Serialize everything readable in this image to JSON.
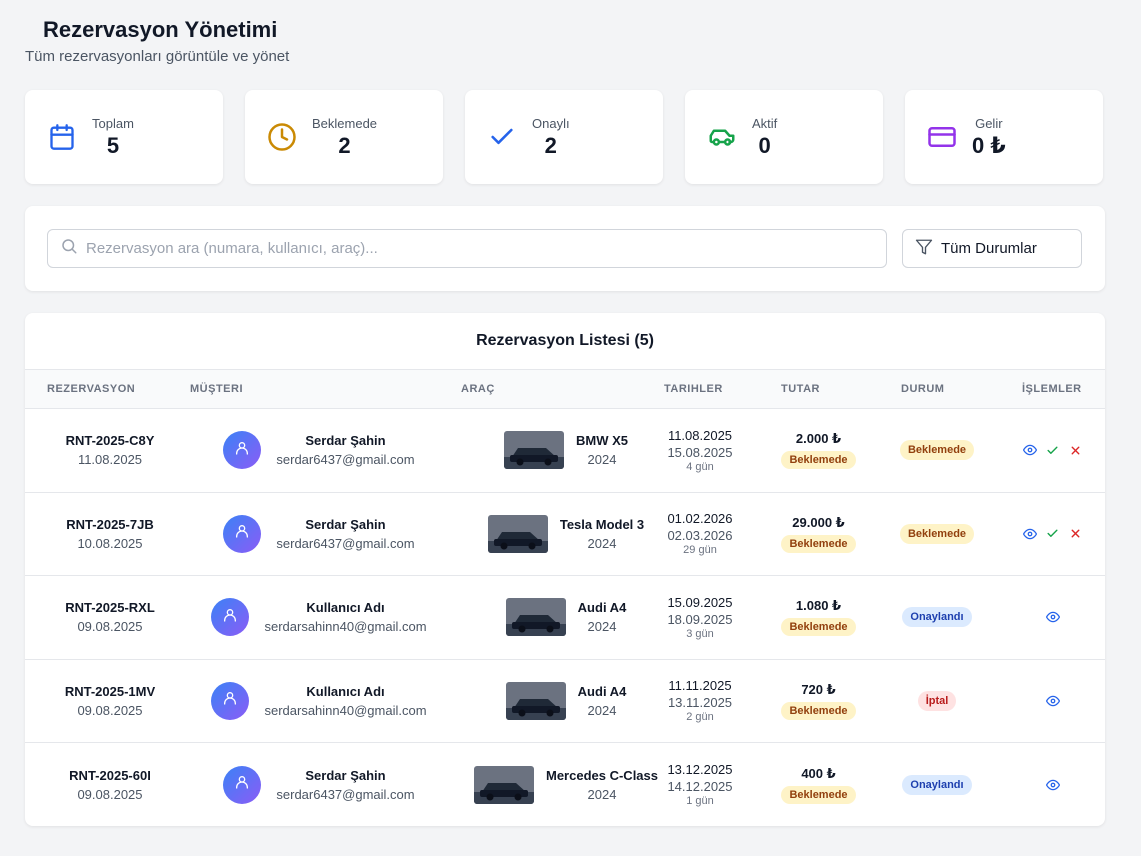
{
  "header": {
    "title": "Rezervasyon Yönetimi",
    "subtitle": "Tüm rezervasyonları görüntüle ve yönet"
  },
  "stats": [
    {
      "label": "Toplam",
      "value": "5",
      "icon": "calendar-icon",
      "color": "#2563eb"
    },
    {
      "label": "Beklemede",
      "value": "2",
      "icon": "clock-icon",
      "color": "#ca8a04"
    },
    {
      "label": "Onaylı",
      "value": "2",
      "icon": "check-icon",
      "color": "#2563eb"
    },
    {
      "label": "Aktif",
      "value": "0",
      "icon": "car-icon",
      "color": "#16a34a"
    },
    {
      "label": "Gelir",
      "value": "0 ₺",
      "icon": "credit-card-icon",
      "color": "#9333ea"
    }
  ],
  "filters": {
    "search_placeholder": "Rezervasyon ara (numara, kullanıcı, araç)...",
    "status_selected": "Tüm Durumlar"
  },
  "list": {
    "title": "Rezervasyon Listesi (5)",
    "columns": [
      "REZERVASYON",
      "MÜŞTERI",
      "ARAÇ",
      "TARIHLER",
      "TUTAR",
      "DURUM",
      "İŞLEMLER"
    ],
    "rows": [
      {
        "res_no": "RNT-2025-C8Y",
        "res_date": "11.08.2025",
        "customer": "Serdar Şahin",
        "email": "serdar6437@gmail.com",
        "car": "BMW X5",
        "year": "2024",
        "start": "11.08.2025",
        "end": "15.08.2025",
        "days": "4 gün",
        "amount": "2.000 ₺",
        "payment": "Beklemede",
        "status": "Beklemede",
        "status_type": "pending"
      },
      {
        "res_no": "RNT-2025-7JB",
        "res_date": "10.08.2025",
        "customer": "Serdar Şahin",
        "email": "serdar6437@gmail.com",
        "car": "Tesla Model 3",
        "year": "2024",
        "start": "01.02.2026",
        "end": "02.03.2026",
        "days": "29 gün",
        "amount": "29.000 ₺",
        "payment": "Beklemede",
        "status": "Beklemede",
        "status_type": "pending"
      },
      {
        "res_no": "RNT-2025-RXL",
        "res_date": "09.08.2025",
        "customer": "Kullanıcı Adı",
        "email": "serdarsahinn40@gmail.com",
        "car": "Audi A4",
        "year": "2024",
        "start": "15.09.2025",
        "end": "18.09.2025",
        "days": "3 gün",
        "amount": "1.080 ₺",
        "payment": "Beklemede",
        "status": "Onaylandı",
        "status_type": "approved"
      },
      {
        "res_no": "RNT-2025-1MV",
        "res_date": "09.08.2025",
        "customer": "Kullanıcı Adı",
        "email": "serdarsahinn40@gmail.com",
        "car": "Audi A4",
        "year": "2024",
        "start": "11.11.2025",
        "end": "13.11.2025",
        "days": "2 gün",
        "amount": "720 ₺",
        "payment": "Beklemede",
        "status": "İptal",
        "status_type": "cancel"
      },
      {
        "res_no": "RNT-2025-60I",
        "res_date": "09.08.2025",
        "customer": "Serdar Şahin",
        "email": "serdar6437@gmail.com",
        "car": "Mercedes C-Class",
        "year": "2024",
        "start": "13.12.2025",
        "end": "14.12.2025",
        "days": "1 gün",
        "amount": "400 ₺",
        "payment": "Beklemede",
        "status": "Onaylandı",
        "status_type": "approved"
      }
    ]
  }
}
